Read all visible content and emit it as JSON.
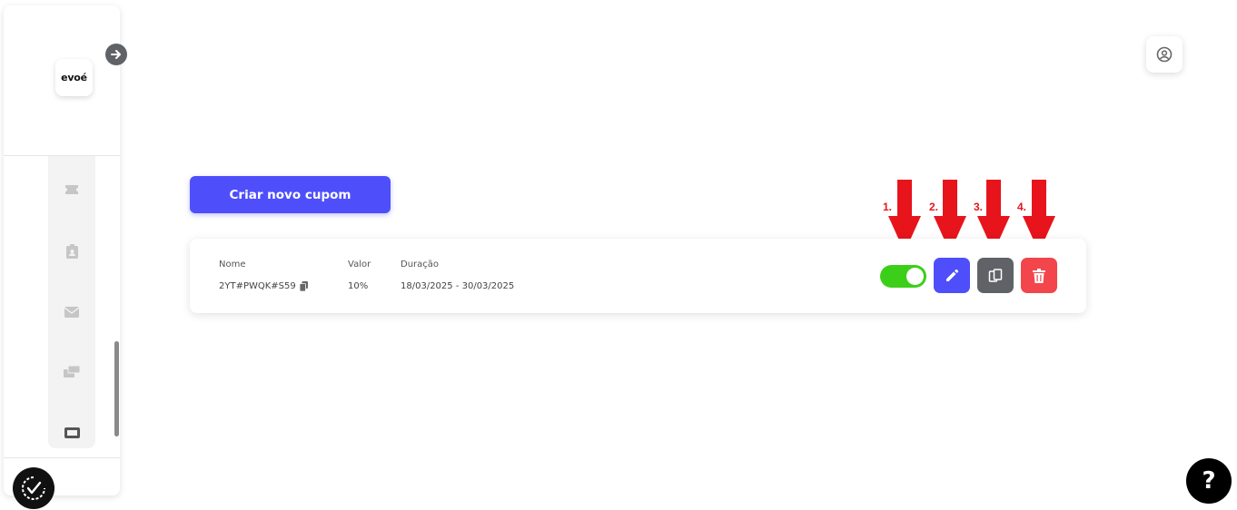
{
  "sidebar": {
    "logo_text": "evoé",
    "nav": [
      {
        "icon": "ticket-icon"
      },
      {
        "icon": "clipboard-icon"
      },
      {
        "icon": "mail-icon"
      },
      {
        "icon": "payment-icon"
      },
      {
        "icon": "coupon-icon",
        "active": true
      }
    ]
  },
  "header": {
    "user_icon": "user-circle-icon"
  },
  "actions": {
    "create_coupon_label": "Criar novo cupom"
  },
  "coupon_list": {
    "columns": {
      "name": "Nome",
      "value": "Valor",
      "duration": "Duração"
    },
    "rows": [
      {
        "name": "2YT#PWQK#S59",
        "value": "10%",
        "duration": "18/03/2025 - 30/03/2025",
        "active": true
      }
    ]
  },
  "annotations": [
    "1.",
    "2.",
    "3.",
    "4."
  ],
  "help": {
    "label": "?"
  },
  "colors": {
    "primary": "#4e4ffb",
    "toggle_on": "#3ccf1a",
    "copy_button": "#5f6368",
    "delete_button": "#f2454c",
    "annotation_red": "#e8141c"
  }
}
